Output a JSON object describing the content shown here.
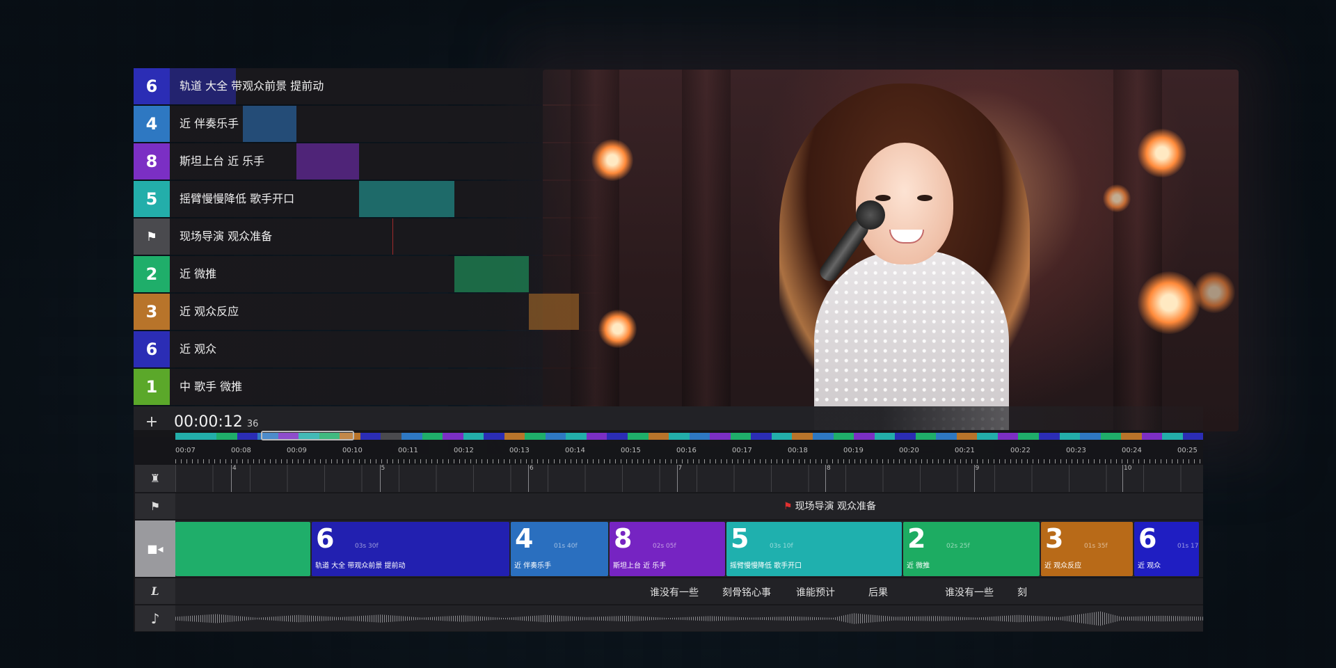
{
  "colors": {
    "track6": "#2b2db5",
    "track4": "#2e78c2",
    "track8": "#7b2fc4",
    "track5": "#23aeaa",
    "marker": "#4a4a4e",
    "track2": "#1fae6a",
    "track3": "#b8742a",
    "track1": "#5ba82a"
  },
  "tracks": [
    {
      "num": "6",
      "label": "轨道 大全 带观众前景 提前动",
      "color": "#2b2db5"
    },
    {
      "num": "4",
      "label": "近 伴奏乐手",
      "color": "#2e78c2"
    },
    {
      "num": "8",
      "label": "斯坦上台 近 乐手",
      "color": "#7b2fc4"
    },
    {
      "num": "5",
      "label": "摇臂慢慢降低 歌手开口",
      "color": "#23aeaa"
    },
    {
      "num": "flag-icon",
      "label": "现场导演 观众准备",
      "color": "#4a4a4e"
    },
    {
      "num": "2",
      "label": "近 微推",
      "color": "#1fae6a"
    },
    {
      "num": "3",
      "label": "近 观众反应",
      "color": "#b8742a"
    },
    {
      "num": "6",
      "label": "近 观众",
      "color": "#2b2db5"
    },
    {
      "num": "1",
      "label": "中 歌手 微推",
      "color": "#5ba82a"
    }
  ],
  "playhead": {
    "timecode": "00:00:12",
    "frames": "36",
    "add_symbol": "+"
  },
  "ruler": {
    "labels": [
      "00:07",
      "00:08",
      "00:09",
      "00:10",
      "00:11",
      "00:12",
      "00:13",
      "00:14",
      "00:15",
      "00:16",
      "00:17",
      "00:18",
      "00:19",
      "00:20",
      "00:21",
      "00:22",
      "00:23",
      "00:24",
      "00:25"
    ]
  },
  "bars": [
    "4",
    "5",
    "6",
    "7",
    "8",
    "9",
    "10"
  ],
  "marker": {
    "label": "现场导演  观众准备"
  },
  "clips": [
    {
      "num": "",
      "dur": "",
      "label": "",
      "color": "#1fae6a"
    },
    {
      "num": "6",
      "dur": "03s 30f",
      "label": "轨道 大全 带观众前景 提前动",
      "color": "#2220b0"
    },
    {
      "num": "4",
      "dur": "01s 40f",
      "label": "近 伴奏乐手",
      "color": "#2a6fbf"
    },
    {
      "num": "8",
      "dur": "02s 05f",
      "label": "斯坦上台 近 乐手",
      "color": "#7624c2"
    },
    {
      "num": "5",
      "dur": "03s 10f",
      "label": "摇臂慢慢降低 歌手开口",
      "color": "#1fb0ae"
    },
    {
      "num": "2",
      "dur": "02s 25f",
      "label": "近 微推",
      "color": "#1dac62"
    },
    {
      "num": "3",
      "dur": "01s 35f",
      "label": "近 观众反应",
      "color": "#b86a18"
    },
    {
      "num": "6",
      "dur": "01s 17",
      "label": "近 观众",
      "color": "#1f1ec2"
    }
  ],
  "lyrics": [
    "谁没有一些",
    "刻骨铭心事",
    "谁能预计",
    "后果",
    "谁没有一些",
    "刻"
  ]
}
